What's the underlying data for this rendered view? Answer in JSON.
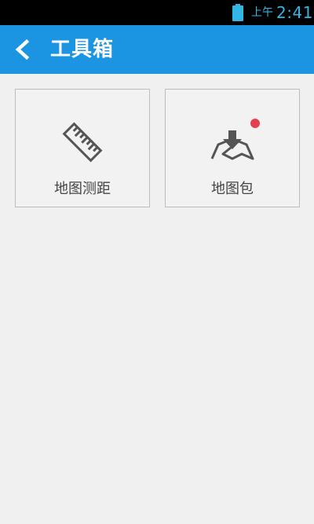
{
  "status_bar": {
    "ampm": "上午",
    "time": "2:41",
    "accent_color": "#33b5e5",
    "battery_icon": "battery-icon"
  },
  "app_bar": {
    "title": "工具箱",
    "background_color": "#1b94e2",
    "back_icon": "chevron-left-icon"
  },
  "tools": [
    {
      "label": "地图测距",
      "icon": "ruler-icon",
      "has_badge": false
    },
    {
      "label": "地图包",
      "icon": "map-download-icon",
      "has_badge": true,
      "badge_color": "#e5404f"
    }
  ]
}
